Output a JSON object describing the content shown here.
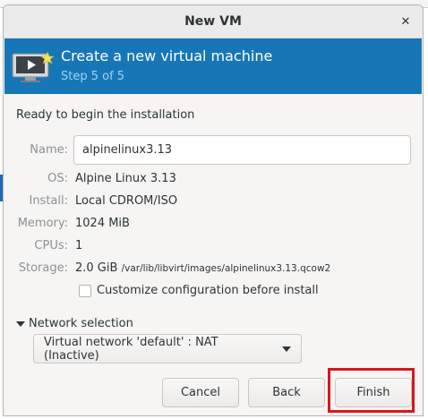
{
  "window": {
    "title": "New VM"
  },
  "icons": {
    "close": "close-icon",
    "vm": "vm-monitor-icon",
    "expander": "triangle-down-icon",
    "dropdown": "triangle-down-icon"
  },
  "banner": {
    "title": "Create a new virtual machine",
    "step": "Step 5 of 5",
    "bg_color": "#1777b6"
  },
  "summary": {
    "heading": "Ready to begin the installation",
    "name_label": "Name:",
    "name_value": "alpinelinux3.13",
    "os_label": "OS:",
    "os_value": "Alpine Linux 3.13",
    "install_label": "Install:",
    "install_value": "Local CDROM/ISO",
    "memory_label": "Memory:",
    "memory_value": "1024 MiB",
    "cpus_label": "CPUs:",
    "cpus_value": "1",
    "storage_label": "Storage:",
    "storage_size": "2.0 GiB",
    "storage_path": "/var/lib/libvirt/images/alpinelinux3.13.qcow2"
  },
  "customize": {
    "label": "Customize configuration before install",
    "checked": false
  },
  "network": {
    "expander_label": "Network selection",
    "selected": "Virtual network 'default' : NAT (Inactive)"
  },
  "buttons": {
    "cancel": "Cancel",
    "back": "Back",
    "finish": "Finish"
  },
  "highlight_color": "#d9161e"
}
